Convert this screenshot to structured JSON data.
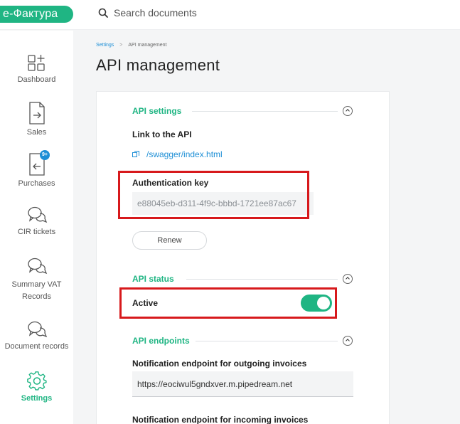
{
  "app": {
    "logo": "e-Фактура",
    "search_placeholder": "Search documents"
  },
  "sidebar": {
    "items": [
      {
        "label": "Dashboard",
        "icon": "dashboard-grid-icon"
      },
      {
        "label": "Sales",
        "icon": "sales-doc-arrow-right-icon"
      },
      {
        "label": "Purchases",
        "icon": "purchases-doc-arrow-left-icon",
        "badge": "9+"
      },
      {
        "label": "CIR tickets",
        "icon": "chat-bubbles-icon"
      },
      {
        "label": "Summary VAT Records",
        "label_line1": "Summary VAT",
        "label_line2": "Records",
        "icon": "chat-bubbles-icon"
      },
      {
        "label": "Document records",
        "icon": "chat-bubbles-icon"
      },
      {
        "label": "Settings",
        "icon": "gear-icon",
        "active": true
      }
    ]
  },
  "breadcrumb": {
    "parent": "Settings",
    "separator": ">",
    "current": "API management"
  },
  "page": {
    "title": "API management"
  },
  "api_settings": {
    "heading": "API settings",
    "link_label": "Link to the API",
    "link_text": "/swagger/index.html",
    "auth_label": "Authentication key",
    "auth_value": "e88045eb-d311-4f9c-bbbd-1721ee87ac67",
    "renew_label": "Renew"
  },
  "api_status": {
    "heading": "API status",
    "active_label": "Active",
    "active": true
  },
  "api_endpoints": {
    "heading": "API endpoints",
    "outgoing_label": "Notification endpoint for outgoing invoices",
    "outgoing_value": "https://eociwul5gndxver.m.pipedream.net",
    "incoming_label": "Notification endpoint for incoming invoices"
  },
  "colors": {
    "accent": "#1fb583",
    "link": "#1e8fd6",
    "highlight": "#d7191c"
  }
}
